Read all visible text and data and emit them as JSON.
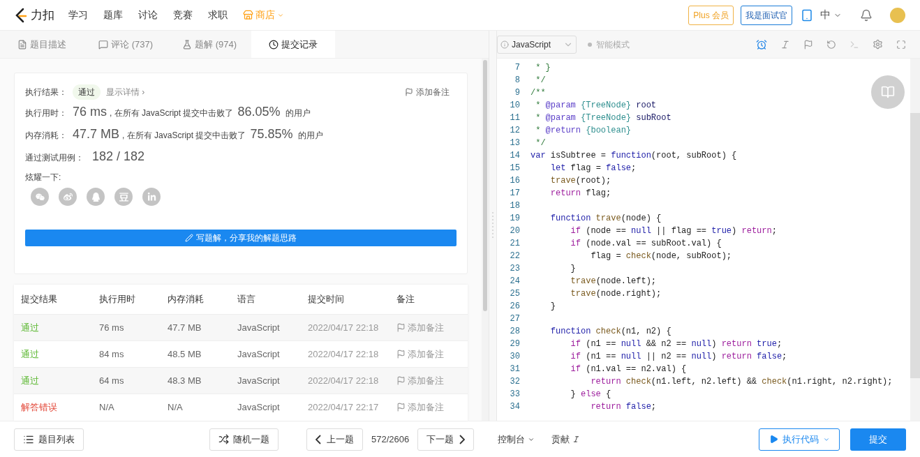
{
  "nav": {
    "logo_text": "力扣",
    "items": [
      {
        "label": "学习",
        "kind": "plain"
      },
      {
        "label": "题库",
        "kind": "plain"
      },
      {
        "label": "讨论",
        "kind": "plain"
      },
      {
        "label": "竞赛",
        "kind": "plain"
      },
      {
        "label": "求职",
        "kind": "plain"
      },
      {
        "label": "商店",
        "kind": "store"
      }
    ],
    "plus": "Plus 会员",
    "interviewer": "我是面试官",
    "language": "中"
  },
  "tabs": [
    {
      "label": "题目描述",
      "selected": false
    },
    {
      "label": "评论 (737)",
      "selected": false
    },
    {
      "label": "题解 (974)",
      "selected": false
    },
    {
      "label": "提交记录",
      "selected": true
    }
  ],
  "editor_toolbar": {
    "language": "JavaScript",
    "mode": "智能模式"
  },
  "result": {
    "status_label": "执行结果：",
    "status": "通过",
    "details": "显示详情 ›",
    "add_note": "添加备注",
    "stats": [
      {
        "label": "执行用时：",
        "value": "76 ms",
        "middle": ", 在所有 JavaScript 提交中击败了",
        "percent": "86.05%",
        "suffix": "的用户"
      },
      {
        "label": "内存消耗：",
        "value": "47.7 MB",
        "middle": ", 在所有 JavaScript 提交中击败了",
        "percent": "75.85%",
        "suffix": "的用户"
      }
    ],
    "cases_label": "通过测试用例：",
    "cases": "182 / 182",
    "share_label": "炫耀一下:",
    "write_button": "写题解，分享我的解题思路"
  },
  "table": {
    "columns": [
      "提交结果",
      "执行用时",
      "内存消耗",
      "语言",
      "提交时间",
      "备注"
    ],
    "rows": [
      {
        "result": "通过",
        "kind": "accepted",
        "time": "76 ms",
        "memory": "47.7 MB",
        "language": "JavaScript",
        "submitted": "2022/04/17 22:18",
        "note": "添加备注"
      },
      {
        "result": "通过",
        "kind": "accepted",
        "time": "84 ms",
        "memory": "48.5 MB",
        "language": "JavaScript",
        "submitted": "2022/04/17 22:18",
        "note": "添加备注"
      },
      {
        "result": "通过",
        "kind": "accepted",
        "time": "64 ms",
        "memory": "48.3 MB",
        "language": "JavaScript",
        "submitted": "2022/04/17 22:18",
        "note": "添加备注"
      },
      {
        "result": "解答错误",
        "kind": "wrong",
        "time": "N/A",
        "memory": "N/A",
        "language": "JavaScript",
        "submitted": "2022/04/17 22:17",
        "note": "添加备注"
      }
    ]
  },
  "code": [
    {
      "n": "7",
      "t": [
        {
          "text": " * }",
          "kind": "cm"
        }
      ]
    },
    {
      "n": "8",
      "t": [
        {
          "text": " */",
          "kind": "cm"
        }
      ]
    },
    {
      "n": "9",
      "t": [
        {
          "text": "/**",
          "kind": "cm"
        }
      ]
    },
    {
      "n": "10",
      "t": [
        {
          "text": " * ",
          "kind": "cm"
        },
        {
          "text": "@param",
          "kind": "tag"
        },
        {
          "text": " {TreeNode}",
          "kind": "type"
        },
        {
          "text": " root",
          "kind": "def"
        }
      ]
    },
    {
      "n": "11",
      "t": [
        {
          "text": " * ",
          "kind": "cm"
        },
        {
          "text": "@param",
          "kind": "tag"
        },
        {
          "text": " {TreeNode}",
          "kind": "type"
        },
        {
          "text": " subRoot",
          "kind": "def"
        }
      ]
    },
    {
      "n": "12",
      "t": [
        {
          "text": " * ",
          "kind": "cm"
        },
        {
          "text": "@return",
          "kind": "tag"
        },
        {
          "text": " {boolean}",
          "kind": "type"
        }
      ]
    },
    {
      "n": "13",
      "t": [
        {
          "text": " */",
          "kind": "cm"
        }
      ]
    },
    {
      "n": "14",
      "t": [
        {
          "text": "var",
          "kind": "kw"
        },
        {
          "text": " isSubtree = ",
          "kind": "pl"
        },
        {
          "text": "function",
          "kind": "kw"
        },
        {
          "text": "(root, subRoot) {",
          "kind": "pl"
        }
      ]
    },
    {
      "n": "15",
      "t": [
        {
          "text": "    let",
          "kind": "kw"
        },
        {
          "text": " flag = ",
          "kind": "pl"
        },
        {
          "text": "false",
          "kind": "atom"
        },
        {
          "text": ";",
          "kind": "pl"
        }
      ]
    },
    {
      "n": "16",
      "t": [
        {
          "text": "    trave",
          "kind": "fn"
        },
        {
          "text": "(root);",
          "kind": "pl"
        }
      ]
    },
    {
      "n": "17",
      "t": [
        {
          "text": "    return",
          "kind": "ctl"
        },
        {
          "text": " flag;",
          "kind": "pl"
        }
      ]
    },
    {
      "n": "18"
    },
    {
      "n": "19",
      "t": [
        {
          "text": "    function",
          "kind": "kw"
        },
        {
          "text": " trave",
          "kind": "fn"
        },
        {
          "text": "(node) {",
          "kind": "pl"
        }
      ]
    },
    {
      "n": "20",
      "t": [
        {
          "text": "        if",
          "kind": "ctl"
        },
        {
          "text": " (node == ",
          "kind": "pl"
        },
        {
          "text": "null",
          "kind": "atom"
        },
        {
          "text": " || flag == ",
          "kind": "pl"
        },
        {
          "text": "true",
          "kind": "atom"
        },
        {
          "text": ") ",
          "kind": "pl"
        },
        {
          "text": "return",
          "kind": "ctl"
        },
        {
          "text": ";",
          "kind": "pl"
        }
      ]
    },
    {
      "n": "21",
      "t": [
        {
          "text": "        if",
          "kind": "ctl"
        },
        {
          "text": " (node.val == subRoot.val) {",
          "kind": "pl"
        }
      ]
    },
    {
      "n": "22",
      "t": [
        {
          "text": "            flag = ",
          "kind": "pl"
        },
        {
          "text": "check",
          "kind": "fn"
        },
        {
          "text": "(node, subRoot);",
          "kind": "pl"
        }
      ]
    },
    {
      "n": "23",
      "t": [
        {
          "text": "        }",
          "kind": "pl"
        }
      ]
    },
    {
      "n": "24",
      "t": [
        {
          "text": "        trave",
          "kind": "fn"
        },
        {
          "text": "(node.left);",
          "kind": "pl"
        }
      ]
    },
    {
      "n": "25",
      "t": [
        {
          "text": "        trave",
          "kind": "fn"
        },
        {
          "text": "(node.right);",
          "kind": "pl"
        }
      ]
    },
    {
      "n": "26",
      "t": [
        {
          "text": "    }",
          "kind": "pl"
        }
      ]
    },
    {
      "n": "27"
    },
    {
      "n": "28",
      "t": [
        {
          "text": "    function",
          "kind": "kw"
        },
        {
          "text": " check",
          "kind": "fn"
        },
        {
          "text": "(n1, n2) {",
          "kind": "pl"
        }
      ]
    },
    {
      "n": "29",
      "t": [
        {
          "text": "        if",
          "kind": "ctl"
        },
        {
          "text": " (n1 == ",
          "kind": "pl"
        },
        {
          "text": "null",
          "kind": "atom"
        },
        {
          "text": " && n2 == ",
          "kind": "pl"
        },
        {
          "text": "null",
          "kind": "atom"
        },
        {
          "text": ") ",
          "kind": "pl"
        },
        {
          "text": "return",
          "kind": "ctl"
        },
        {
          "text": " true",
          "kind": "atom"
        },
        {
          "text": ";",
          "kind": "pl"
        }
      ]
    },
    {
      "n": "30",
      "t": [
        {
          "text": "        if",
          "kind": "ctl"
        },
        {
          "text": " (n1 == ",
          "kind": "pl"
        },
        {
          "text": "null",
          "kind": "atom"
        },
        {
          "text": " || n2 == ",
          "kind": "pl"
        },
        {
          "text": "null",
          "kind": "atom"
        },
        {
          "text": ") ",
          "kind": "pl"
        },
        {
          "text": "return",
          "kind": "ctl"
        },
        {
          "text": " false",
          "kind": "atom"
        },
        {
          "text": ";",
          "kind": "pl"
        }
      ]
    },
    {
      "n": "31",
      "t": [
        {
          "text": "        if",
          "kind": "ctl"
        },
        {
          "text": " (n1.val == n2.val) {",
          "kind": "pl"
        }
      ]
    },
    {
      "n": "32",
      "t": [
        {
          "text": "            return",
          "kind": "ctl"
        },
        {
          "text": " check",
          "kind": "fn"
        },
        {
          "text": "(n1.left, n2.left) && ",
          "kind": "pl"
        },
        {
          "text": "check",
          "kind": "fn"
        },
        {
          "text": "(n1.right, n2.right);",
          "kind": "pl"
        }
      ]
    },
    {
      "n": "33",
      "t": [
        {
          "text": "        } ",
          "kind": "pl"
        },
        {
          "text": "else",
          "kind": "ctl"
        },
        {
          "text": " {",
          "kind": "pl"
        }
      ]
    },
    {
      "n": "34",
      "t": [
        {
          "text": "            return",
          "kind": "ctl"
        },
        {
          "text": " false",
          "kind": "atom"
        },
        {
          "text": ";",
          "kind": "pl"
        }
      ]
    }
  ],
  "bottom": {
    "list": "题目列表",
    "random": "随机一题",
    "prev": "上一题",
    "progress": "572/2606",
    "next": "下一题",
    "console": "控制台",
    "contribute": "贡献",
    "run": "执行代码",
    "submit": "提交"
  }
}
